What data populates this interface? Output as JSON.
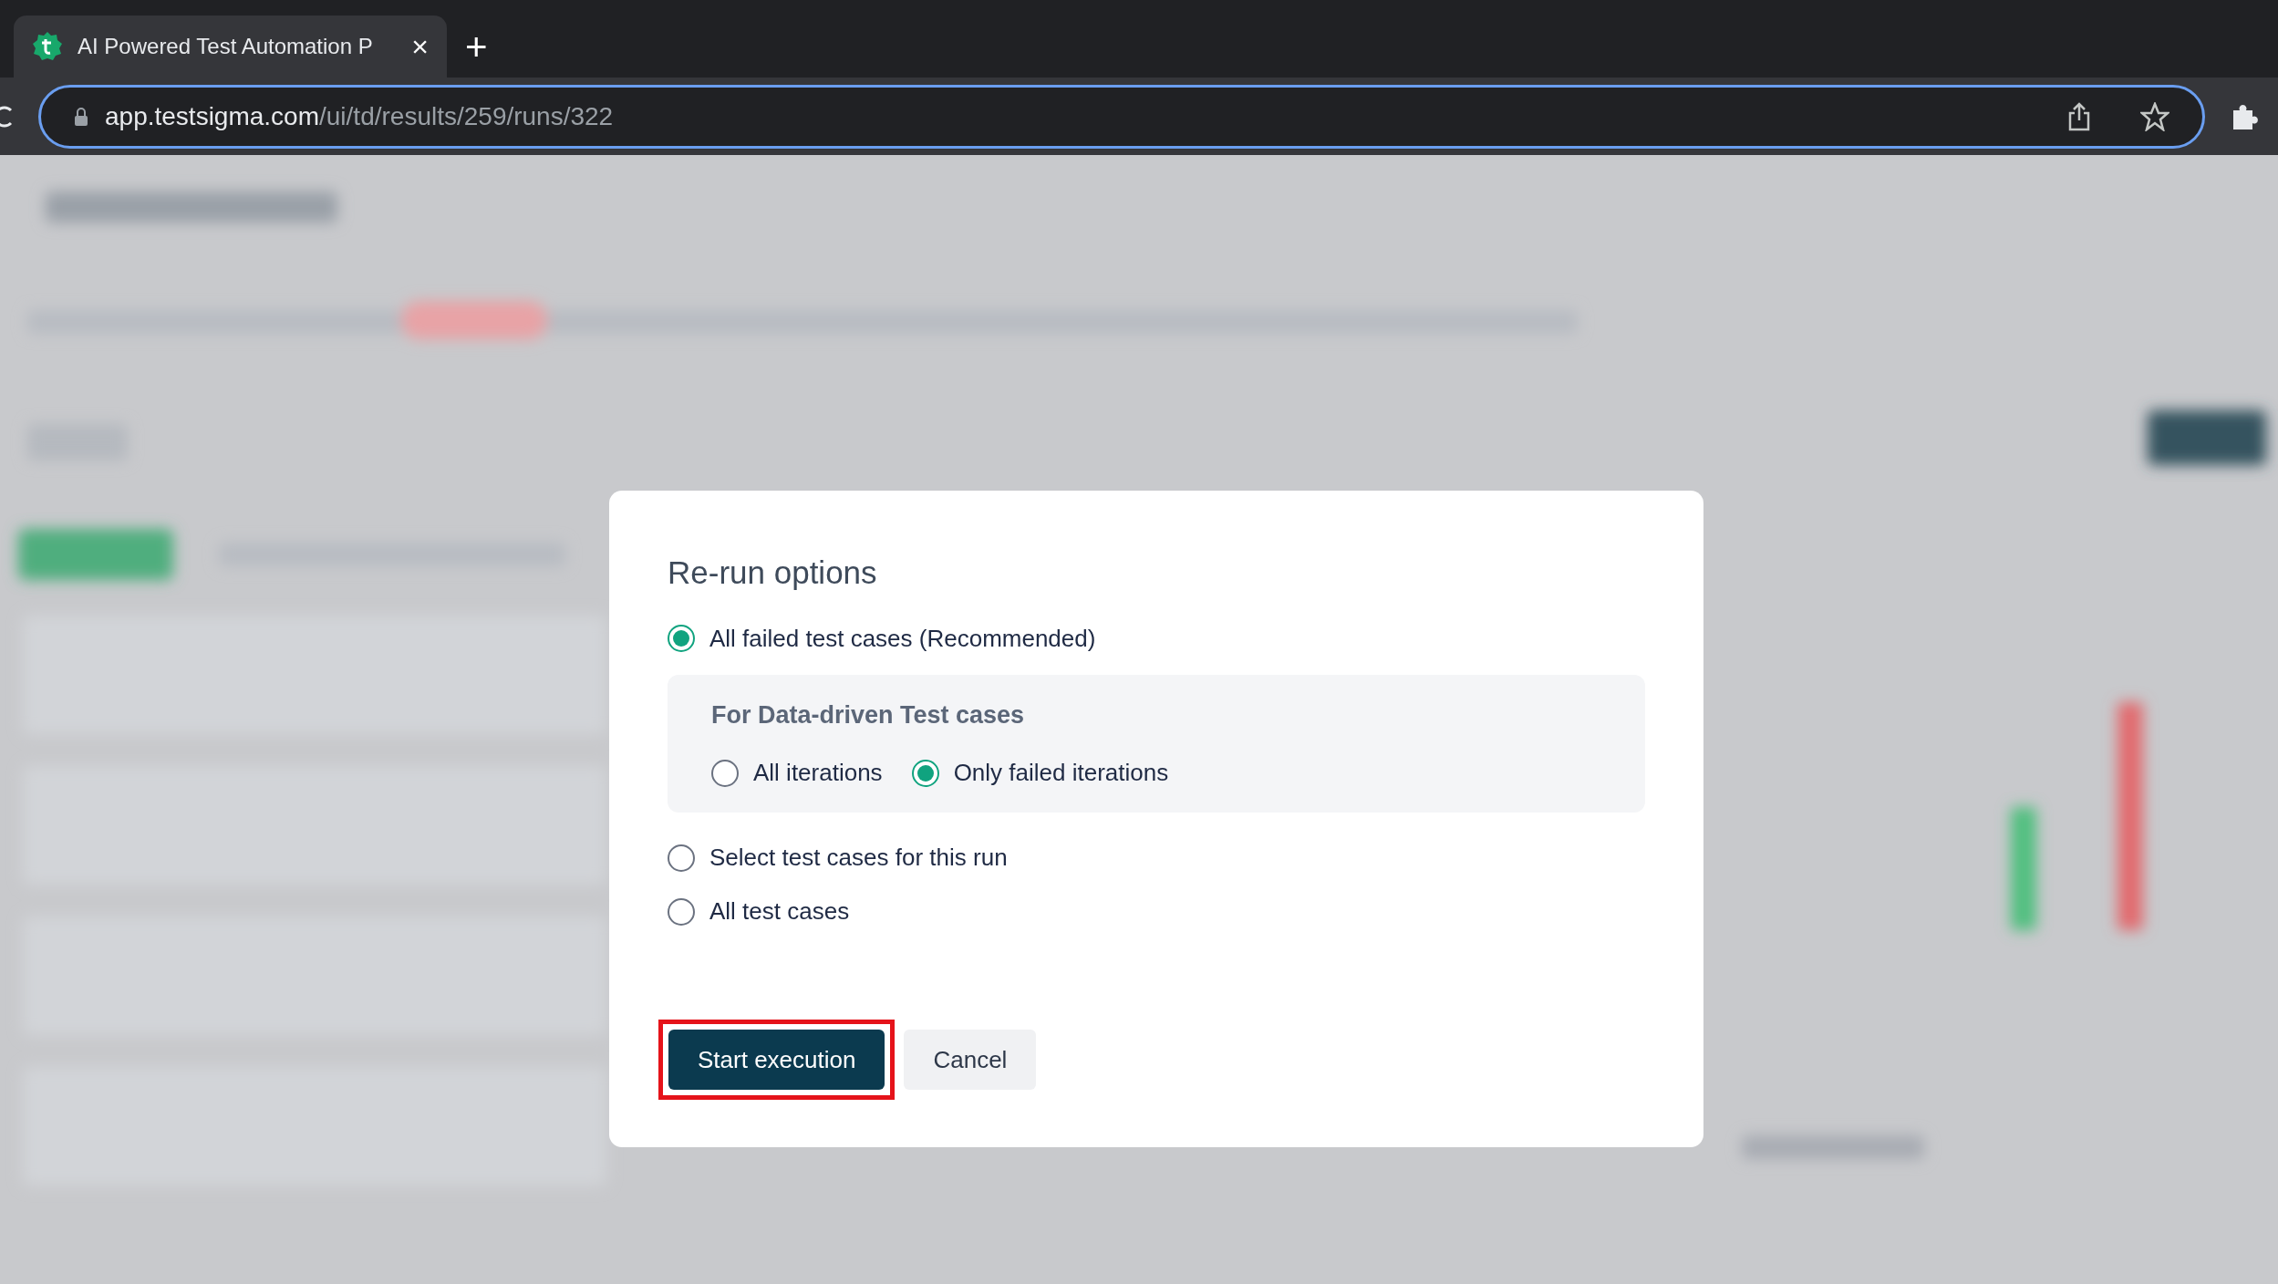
{
  "browser": {
    "tab": {
      "title": "AI Powered Test Automation P",
      "close": "×",
      "new_tab": "+"
    },
    "url_host": "app.testsigma.com",
    "url_path": "/ui/td/results/259/runs/322"
  },
  "dialog": {
    "title": "Re-run options",
    "options": [
      {
        "label": "All failed test cases (Recommended)",
        "selected": true
      },
      {
        "kind": "group",
        "title": "For Data-driven Test cases",
        "choices": [
          {
            "label": "All iterations",
            "selected": false
          },
          {
            "label": "Only failed iterations",
            "selected": true
          }
        ]
      },
      {
        "label": "Select test cases for this run",
        "selected": false
      },
      {
        "label": "All test cases",
        "selected": false
      }
    ],
    "buttons": [
      {
        "label": "Start execution",
        "kind": "primary",
        "highlighted": true
      },
      {
        "label": "Cancel",
        "kind": "secondary",
        "highlighted": false
      }
    ]
  }
}
